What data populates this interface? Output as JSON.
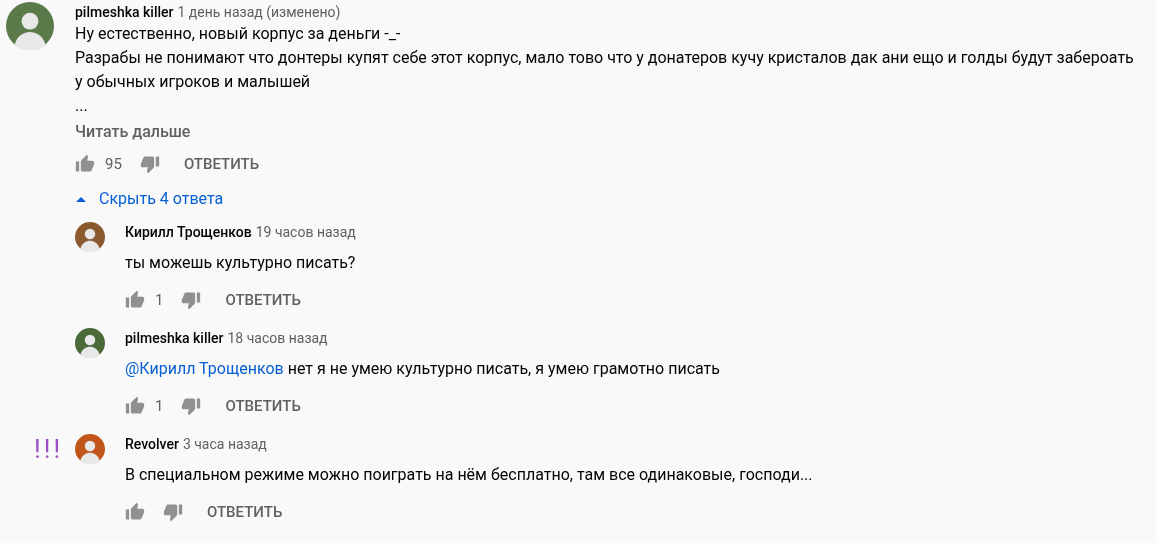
{
  "comment": {
    "author": "pilmeshka killer",
    "time": "1 день назад (изменено)",
    "lines": [
      "Ну естественно, новый корпус за деньги -_-",
      "Разрабы не понимают что донтеры купят себе этот корпус, мало тово что у донатеров кучу кристалов дак ани ещо и голды будут забероать у обычных игроков и малышей",
      "..."
    ],
    "read_more": "Читать дальше",
    "likes": "95",
    "reply": "ОТВЕТИТЬ",
    "toggle": {
      "label": "Скрыть 4 ответа",
      "expanded": true
    }
  },
  "replies": [
    {
      "author": "Кирилл Трощенков",
      "time": "19 часов назад",
      "text": "ты можешь культурно писать?",
      "likes": "1",
      "reply": "ОТВЕТИТЬ"
    },
    {
      "author": "pilmeshka killer",
      "time": "18 часов назад",
      "mention": "@Кирилл Трощенков",
      "text": "нет я не умею культурно писать, я умею грамотно писать",
      "likes": "1",
      "reply": "ОТВЕТИТЬ"
    },
    {
      "author": "Revolver",
      "time": "3 часа назад",
      "text": "В специальном режиме можно поиграть на нём бесплатно, там все одинаковые, господи...",
      "reply": "ОТВЕТИТЬ",
      "note": "!!!"
    }
  ]
}
